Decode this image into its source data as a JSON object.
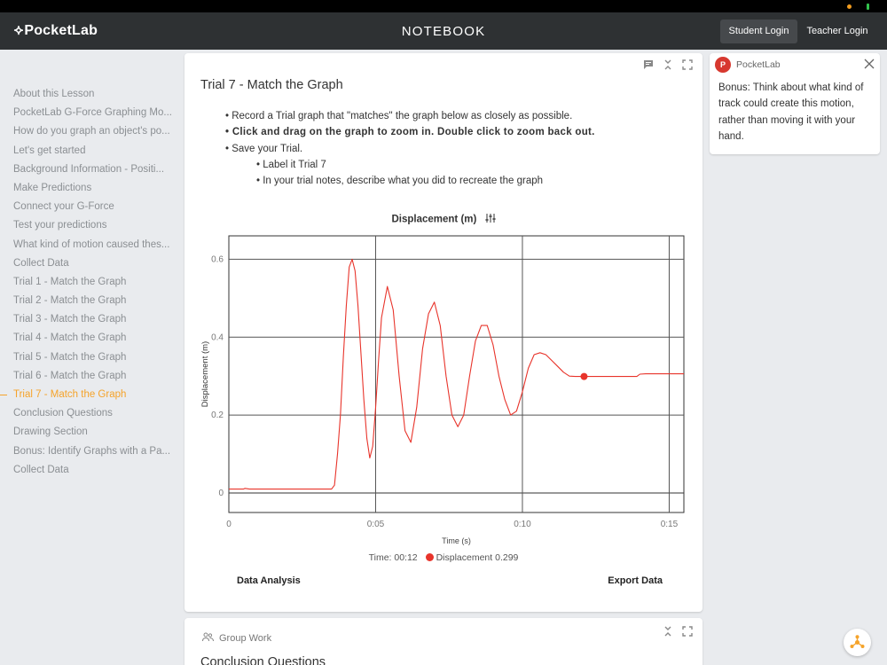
{
  "app": {
    "logo": "PocketLab",
    "title": "NOTEBOOK",
    "student_login": "Student Login",
    "teacher_login": "Teacher Login",
    "accent_color": "#f5a32a"
  },
  "sidebar": {
    "items": [
      {
        "label": "About this Lesson"
      },
      {
        "label": "PocketLab G-Force Graphing Mo..."
      },
      {
        "label": "How do you graph an object's po..."
      },
      {
        "label": "Let's get started"
      },
      {
        "label": "Background Information - Positi..."
      },
      {
        "label": "Make Predictions"
      },
      {
        "label": "Connect your G-Force"
      },
      {
        "label": "Test your predictions"
      },
      {
        "label": "What kind of motion caused thes..."
      },
      {
        "label": "Collect Data"
      },
      {
        "label": "Trial 1 - Match the Graph"
      },
      {
        "label": "Trial 2 - Match the Graph"
      },
      {
        "label": "Trial 3 - Match the Graph"
      },
      {
        "label": "Trial 4 - Match the Graph"
      },
      {
        "label": "Trial 5 - Match the Graph"
      },
      {
        "label": "Trial 6 - Match the Graph"
      },
      {
        "label": "Trial 7 - Match the Graph",
        "active": true
      },
      {
        "label": "Conclusion Questions"
      },
      {
        "label": "Drawing Section"
      },
      {
        "label": "Bonus: Identify Graphs with a Pa..."
      },
      {
        "label": "Collect Data"
      }
    ]
  },
  "main": {
    "title": "Trial 7 - Match the Graph",
    "icons": [
      "comment-icon",
      "collapse-icon",
      "expand-icon"
    ],
    "bullets": [
      "Record a Trial graph that \"matches\" the graph below as closely as possible.",
      "Click and drag on the graph to zoom in. Double click to zoom back out.",
      "Save your Trial.",
      "Label it Trial 7",
      "In your trial notes, describe what you did to recreate the graph"
    ],
    "data_analysis": "Data Analysis",
    "export_data": "Export Data"
  },
  "chart_data": {
    "type": "line",
    "title": "Displacement (m)",
    "xlabel": "Time (s)",
    "ylabel": "Displacement (m)",
    "xlim": [
      0,
      15.5
    ],
    "ylim": [
      -0.05,
      0.66
    ],
    "x_ticks": [
      0,
      5,
      10,
      15
    ],
    "x_tick_labels": [
      "0",
      "0:05",
      "0:10",
      "0:15"
    ],
    "y_ticks": [
      0,
      0.2,
      0.4,
      0.6
    ],
    "y_tick_labels": [
      "0",
      "0.2",
      "0.4",
      "0.6"
    ],
    "grid": true,
    "line_color": "#e8342b",
    "series": [
      {
        "x": [
          0,
          0.5,
          0.55,
          0.7,
          3.5,
          3.6,
          3.7,
          3.8,
          3.9,
          4.0,
          4.1,
          4.2,
          4.3,
          4.4,
          4.5,
          4.6,
          4.7,
          4.8,
          4.9,
          5.0,
          5.1,
          5.2,
          5.4,
          5.6,
          5.8,
          6.0,
          6.2,
          6.4,
          6.6,
          6.8,
          7.0,
          7.2,
          7.4,
          7.6,
          7.8,
          8.0,
          8.2,
          8.4,
          8.6,
          8.8,
          9.0,
          9.2,
          9.4,
          9.6,
          9.8,
          10.0,
          10.2,
          10.4,
          10.6,
          10.8,
          11.0,
          11.2,
          11.4,
          11.6,
          11.8,
          12.0,
          12.2,
          12.5,
          13.0,
          13.5,
          13.9,
          14.0,
          14.2,
          14.5,
          15.0,
          15.5
        ],
        "y": [
          0.01,
          0.01,
          0.012,
          0.01,
          0.01,
          0.02,
          0.1,
          0.2,
          0.35,
          0.48,
          0.58,
          0.6,
          0.57,
          0.48,
          0.36,
          0.24,
          0.14,
          0.09,
          0.12,
          0.22,
          0.34,
          0.45,
          0.53,
          0.47,
          0.3,
          0.16,
          0.13,
          0.22,
          0.37,
          0.46,
          0.49,
          0.43,
          0.3,
          0.2,
          0.17,
          0.2,
          0.3,
          0.39,
          0.43,
          0.43,
          0.38,
          0.3,
          0.24,
          0.2,
          0.21,
          0.26,
          0.32,
          0.355,
          0.36,
          0.355,
          0.34,
          0.325,
          0.31,
          0.3,
          0.299,
          0.299,
          0.299,
          0.299,
          0.299,
          0.299,
          0.299,
          0.305,
          0.306,
          0.306,
          0.306,
          0.306
        ]
      }
    ],
    "marker": {
      "x": 12.1,
      "y": 0.299
    },
    "legend": {
      "time": "Time: 00:12",
      "label": "Displacement 0.299"
    }
  },
  "group": {
    "label": "Group Work",
    "section_title": "Conclusion Questions"
  },
  "note": {
    "avatar": "P",
    "name": "PocketLab",
    "text": "Bonus: Think about what kind of track could create this motion, rather than moving it with your hand."
  }
}
